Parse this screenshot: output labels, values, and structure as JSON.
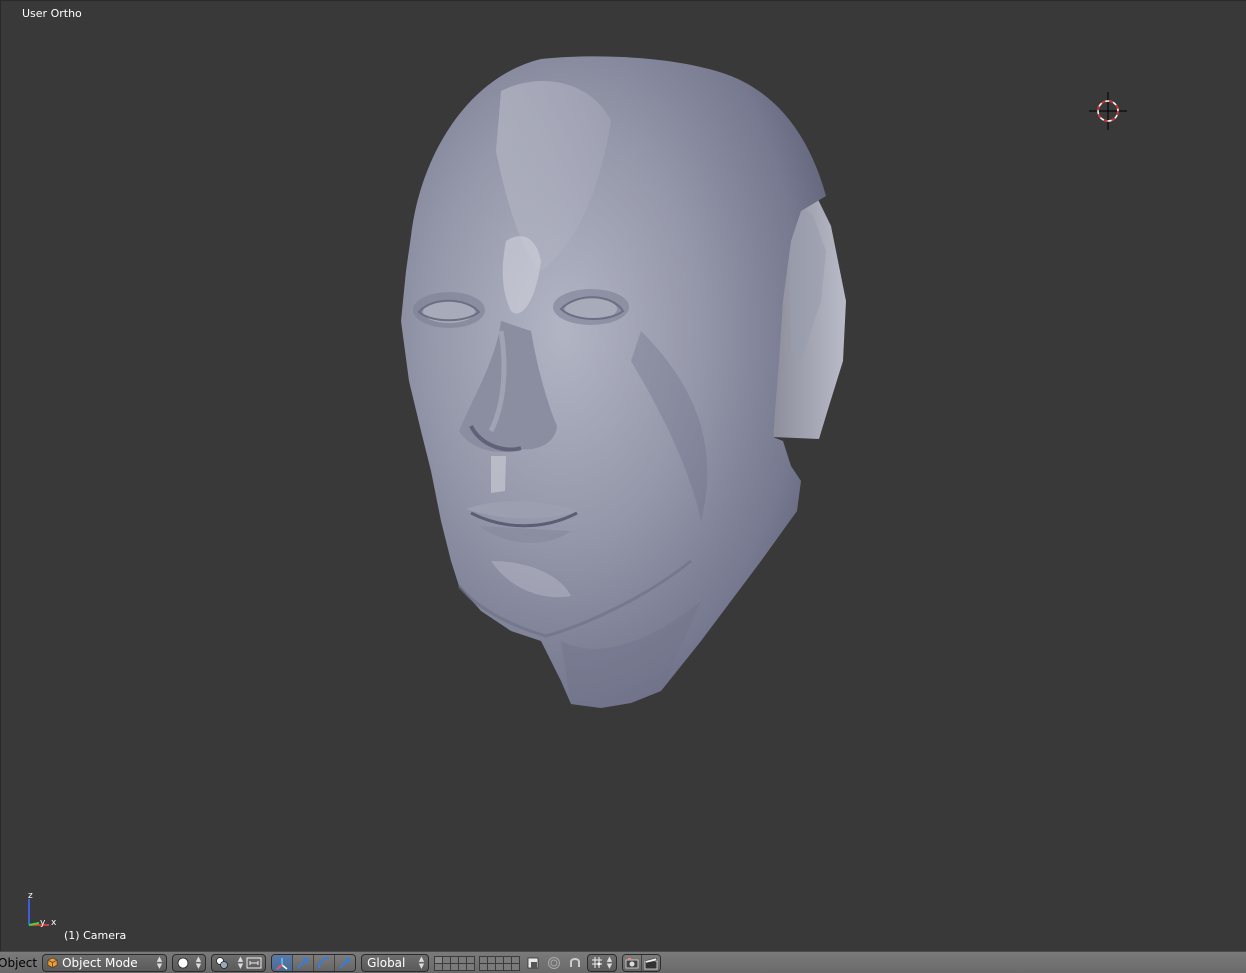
{
  "viewport": {
    "view_label": "User Ortho",
    "object_label": "(1) Camera",
    "background_color": "#393939",
    "axis_labels": {
      "x": "x",
      "y": "y",
      "z": "z"
    }
  },
  "header": {
    "menu_object": "Object",
    "mode_dropdown": {
      "value": "Object Mode",
      "icon": "cube-icon"
    },
    "shading_dropdown": {
      "icon": "solid-sphere-icon"
    },
    "pivot_dropdown": {
      "icon": "pivot-icon"
    },
    "manipulator_buttons": [
      {
        "icon": "manipulator-toggle-icon",
        "active": true
      },
      {
        "icon": "translate-arrow-icon",
        "active": false
      },
      {
        "icon": "rotate-arc-icon",
        "active": false
      },
      {
        "icon": "scale-icon",
        "active": false
      }
    ],
    "orientation_dropdown": {
      "value": "Global"
    },
    "icons": {
      "lock": "lock-layers-icon",
      "proportional": "proportional-edit-icon",
      "snap_magnet": "snap-magnet-icon",
      "snap_element": "snap-element-icon",
      "render": "render-camera-icon",
      "render_anim": "clapper-icon"
    }
  }
}
